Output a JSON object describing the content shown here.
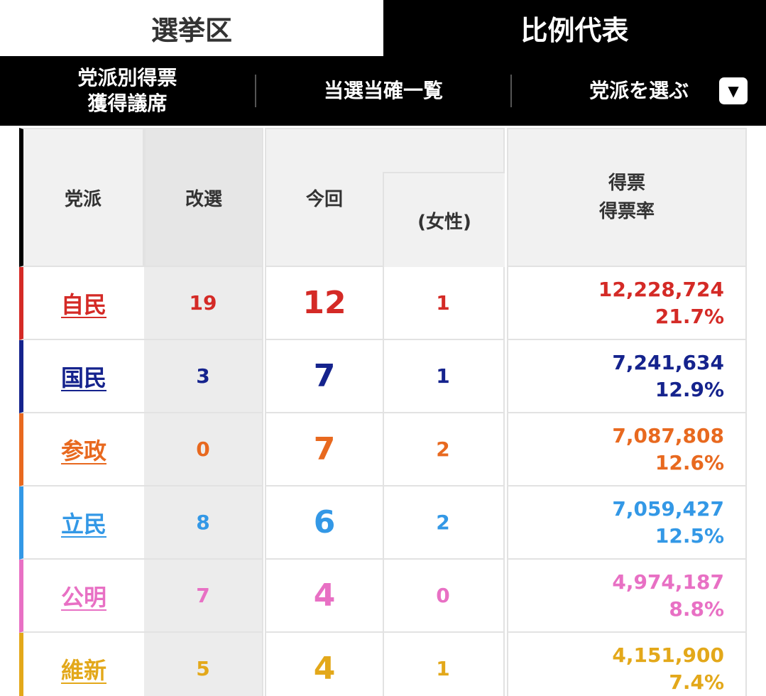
{
  "tabs": {
    "district": "選挙区",
    "pr": "比例代表"
  },
  "subnav": {
    "item1_line1": "党派別得票",
    "item1_line2": "獲得議席",
    "item2": "当選当確一覧",
    "item3": "党派を選ぶ",
    "dropdown_icon": "▼"
  },
  "table": {
    "headers": {
      "party": "党派",
      "kaisen": "改選",
      "konkai": "今回",
      "female": "(女性)",
      "votes": "得票",
      "rate": "得票率"
    },
    "rows": [
      {
        "party": "自民",
        "kaisen": "19",
        "konkai": "12",
        "female": "1",
        "votes": "12,228,724",
        "rate": "21.7%",
        "color": "#d42a26"
      },
      {
        "party": "国民",
        "kaisen": "3",
        "konkai": "7",
        "female": "1",
        "votes": "7,241,634",
        "rate": "12.9%",
        "color": "#15238d"
      },
      {
        "party": "参政",
        "kaisen": "0",
        "konkai": "7",
        "female": "2",
        "votes": "7,087,808",
        "rate": "12.6%",
        "color": "#e8691f"
      },
      {
        "party": "立民",
        "kaisen": "8",
        "konkai": "6",
        "female": "2",
        "votes": "7,059,427",
        "rate": "12.5%",
        "color": "#3398e6"
      },
      {
        "party": "公明",
        "kaisen": "7",
        "konkai": "4",
        "female": "0",
        "votes": "4,974,187",
        "rate": "8.8%",
        "color": "#e870c4"
      },
      {
        "party": "維新",
        "kaisen": "5",
        "konkai": "4",
        "female": "1",
        "votes": "4,151,900",
        "rate": "7.4%",
        "color": "#e3a81a"
      }
    ]
  }
}
